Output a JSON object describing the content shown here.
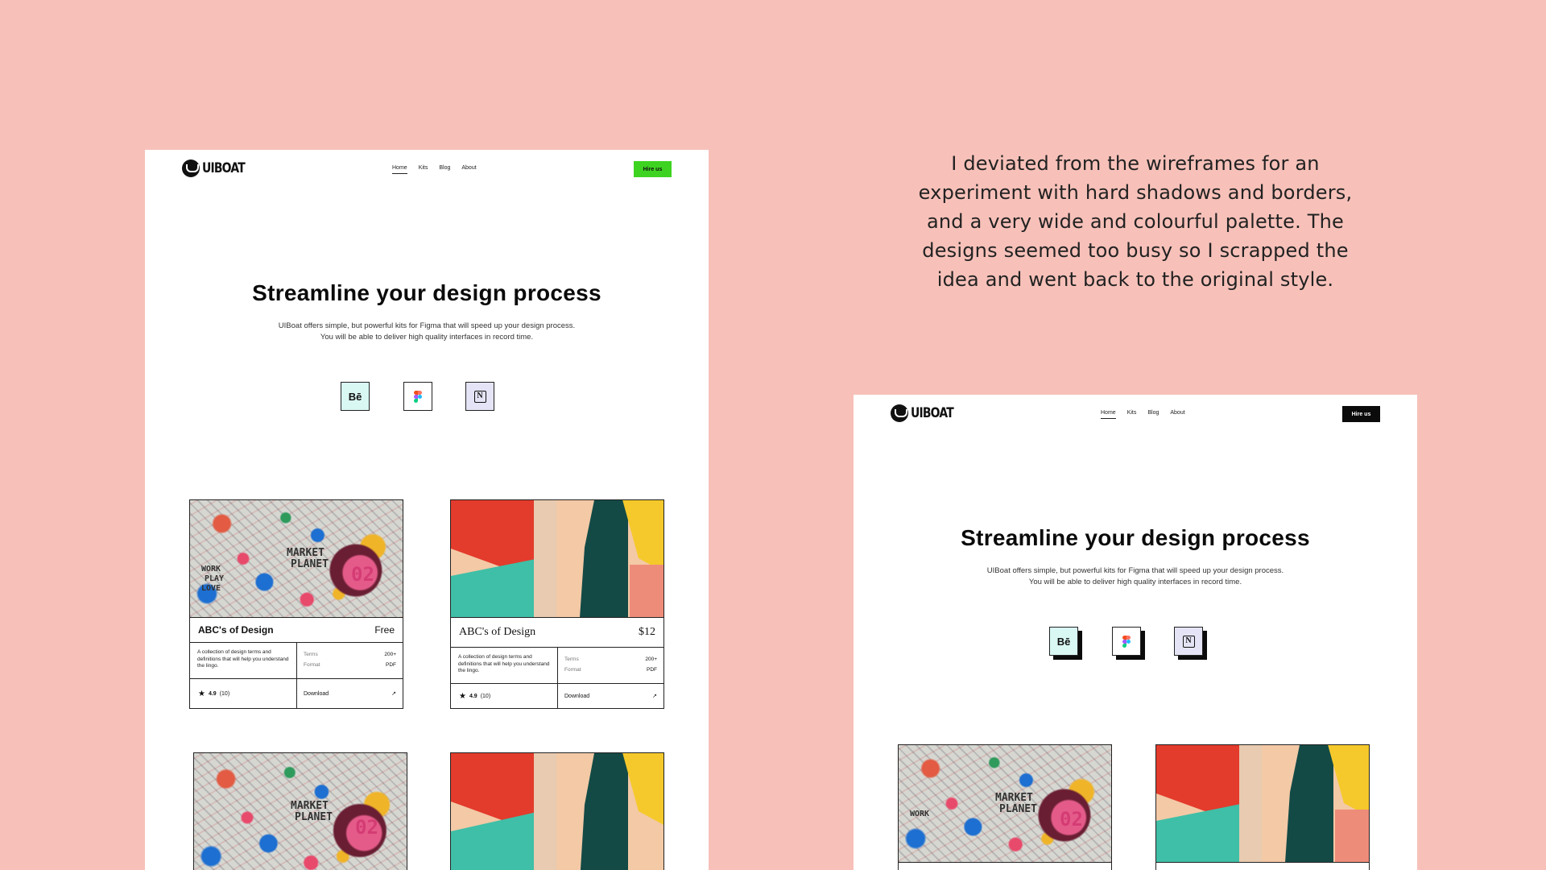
{
  "caption": "I deviated from the wireframes for an experiment with hard shadows and borders, and a very wide and colourful palette. The designs seemed too busy so I scrapped the idea and went back to the original style.",
  "colors": {
    "background": "#f7c1b9",
    "cta_green": "#3ed321",
    "cta_black": "#0b0b0b"
  },
  "left_mockup": {
    "logo": "UIBOAT",
    "nav": [
      "Home",
      "Kits",
      "Blog",
      "About"
    ],
    "cta": "Hire us",
    "hero_title": "Streamline your design process",
    "hero_sub": "UIBoat offers simple, but powerful kits for Figma that will speed up your design process. You will be able to deliver high quality interfaces in record time.",
    "icons": [
      {
        "name": "behance-icon",
        "label": "Bē"
      },
      {
        "name": "figma-icon",
        "label": ""
      },
      {
        "name": "notion-icon",
        "label": "N"
      }
    ],
    "cards": [
      {
        "image": "graffiti",
        "title": "ABC's of Design",
        "price": "Free",
        "description": "A collection of design terms and definitions that will help you understand the lingo.",
        "meta_labels": [
          "Terms",
          "Format"
        ],
        "meta_values": [
          "200+",
          "PDF"
        ],
        "rating": "4.9",
        "rating_count": "(10)",
        "download": "Download",
        "arrow": "↗"
      },
      {
        "image": "abstract",
        "title": "ABC's of Design",
        "price": "$12",
        "description": "A collection of design terms and definitions that will help you understand the lingo.",
        "meta_labels": [
          "Terms",
          "Format"
        ],
        "meta_values": [
          "200+",
          "PDF"
        ],
        "rating": "4.9",
        "rating_count": "(10)",
        "download": "Download",
        "arrow": "↗"
      }
    ]
  },
  "right_mockup": {
    "logo": "UIBOAT",
    "nav": [
      "Home",
      "Kits",
      "Blog",
      "About"
    ],
    "cta": "Hire us",
    "hero_title": "Streamline your design process",
    "hero_sub": "UIBoat offers simple, but powerful kits for Figma that will speed up your design process. You will be able to deliver high quality interfaces in record time.",
    "icons": [
      {
        "name": "behance-icon",
        "label": "Bē"
      },
      {
        "name": "figma-icon",
        "label": ""
      },
      {
        "name": "notion-icon",
        "label": "N"
      }
    ]
  },
  "graffiti_words": [
    "MARKET",
    "PLANET",
    "WORK",
    "PLAY",
    "LOVE",
    "02"
  ]
}
